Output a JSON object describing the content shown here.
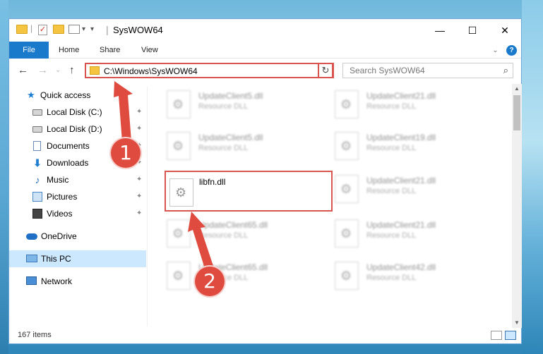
{
  "window": {
    "title": "SysWOW64",
    "minimize_glyph": "—",
    "maximize_glyph": "☐",
    "close_glyph": "✕"
  },
  "quick_access_toolbar": {
    "icons": [
      "folder-icon",
      "properties-check-icon",
      "new-folder-icon",
      "customize-dropdown-icon"
    ],
    "dropdown_glyph": "▾",
    "separator": "|"
  },
  "ribbon": {
    "tabs": [
      "File",
      "Home",
      "Share",
      "View"
    ],
    "expand_glyph": "⌄",
    "help_glyph": "?"
  },
  "navigation": {
    "back_glyph": "←",
    "forward_glyph": "→",
    "recent_glyph": "⌄",
    "up_glyph": "↑",
    "address": "C:\\Windows\\SysWOW64",
    "address_dropdown_glyph": "⌄",
    "refresh_glyph": "↻",
    "search_placeholder": "Search SysWOW64",
    "search_glyph": "⌕"
  },
  "sidebar": {
    "pin_glyph": "✦",
    "items": [
      {
        "label": "Quick access",
        "icon": "star-icon"
      },
      {
        "label": "Local Disk (C:)",
        "icon": "local-disk-icon",
        "pinned": true
      },
      {
        "label": "Local Disk (D:)",
        "icon": "local-disk-icon",
        "pinned": true
      },
      {
        "label": "Documents",
        "icon": "documents-icon",
        "pinned": true
      },
      {
        "label": "Downloads",
        "icon": "downloads-icon",
        "pinned": true
      },
      {
        "label": "Music",
        "icon": "music-icon",
        "pinned": true
      },
      {
        "label": "Pictures",
        "icon": "pictures-icon",
        "pinned": true
      },
      {
        "label": "Videos",
        "icon": "videos-icon",
        "pinned": true
      },
      {
        "label": "OneDrive",
        "icon": "onedrive-icon"
      },
      {
        "label": "This PC",
        "icon": "this-pc-icon",
        "selected": true
      },
      {
        "label": "Network",
        "icon": "network-icon"
      }
    ]
  },
  "files": [
    {
      "name": "UpdateClient5.dll",
      "type": "Resource DLL",
      "blurred": true
    },
    {
      "name": "UpdateClient21.dll",
      "type": "Resource DLL",
      "blurred": true
    },
    {
      "name": "UpdateClient5.dll",
      "type": "Resource DLL",
      "blurred": true
    },
    {
      "name": "UpdateClient19.dll",
      "type": "Resource DLL",
      "blurred": true
    },
    {
      "name": "libfn.dll",
      "type": "",
      "highlighted": true
    },
    {
      "name": "UpdateClient21.dll",
      "type": "Resource DLL",
      "blurred": true
    },
    {
      "name": "UpdateClient65.dll",
      "type": "Resource DLL",
      "blurred": true
    },
    {
      "name": "UpdateClient21.dll",
      "type": "Resource DLL",
      "blurred": true
    },
    {
      "name": "UpdateClient65.dll",
      "type": "Resource DLL",
      "blurred": true
    },
    {
      "name": "UpdateClient42.dll",
      "type": "Resource DLL",
      "blurred": true
    }
  ],
  "scrollbar": {
    "up_glyph": "▲",
    "down_glyph": "▼"
  },
  "status": {
    "items_count": "167 items"
  },
  "annotations": {
    "step1": "1",
    "step2": "2",
    "color": "#e04b3f"
  },
  "colors": {
    "accent": "#1979ca",
    "highlight_border": "#d9534f",
    "selection": "#cce8ff"
  }
}
